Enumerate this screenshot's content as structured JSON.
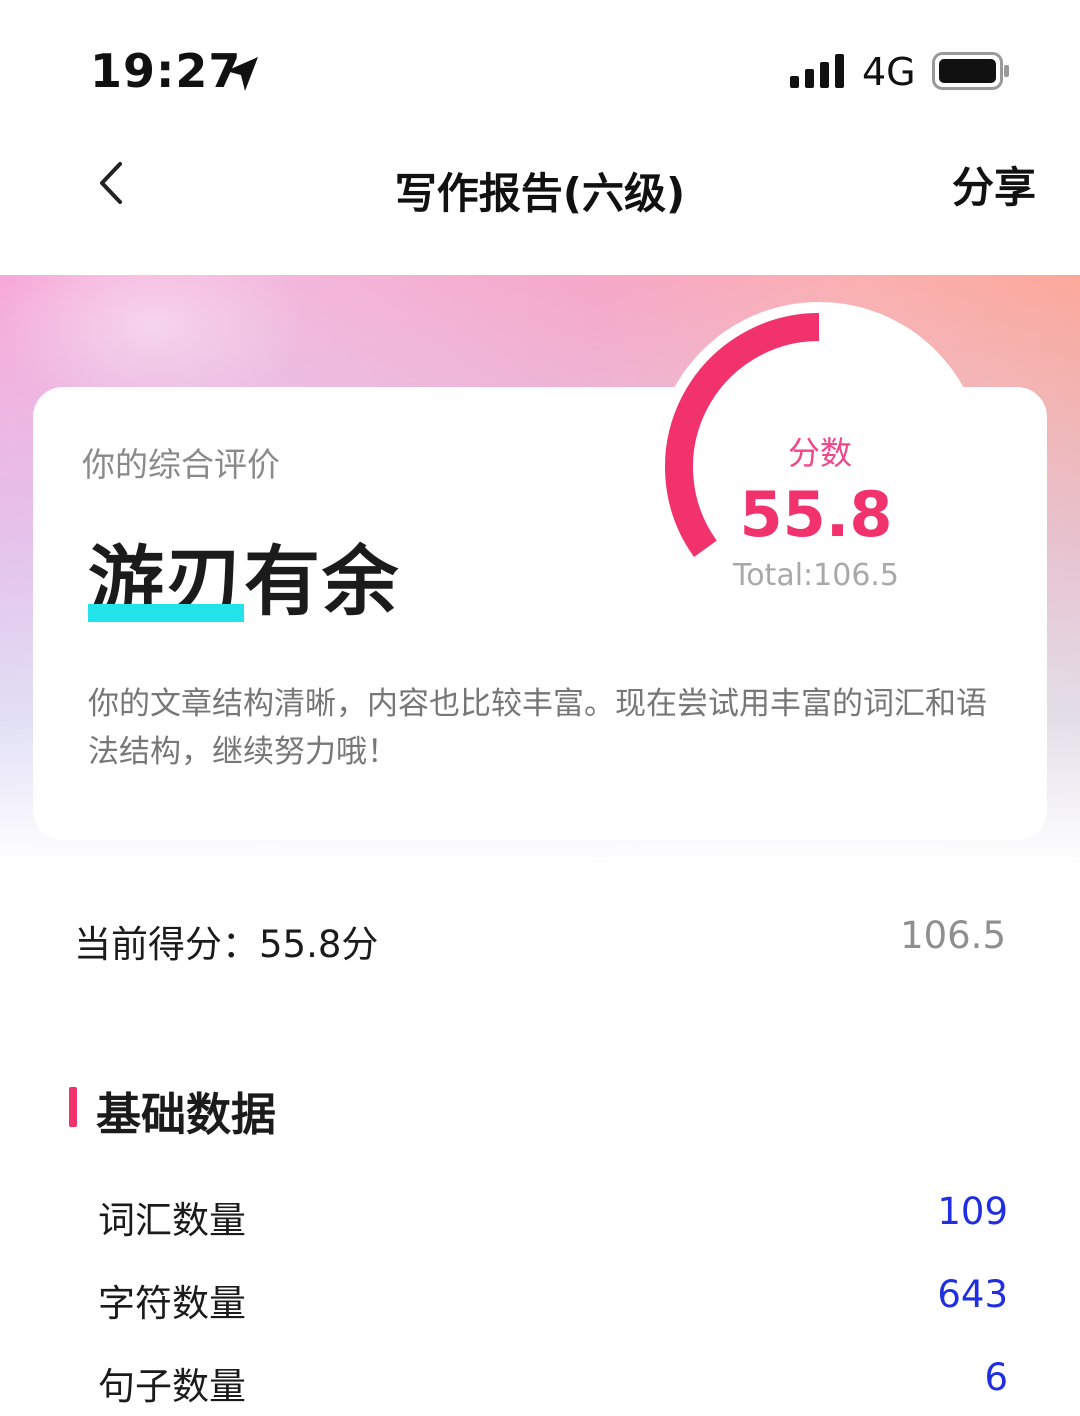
{
  "status_bar": {
    "time": "19:27",
    "network": "4G",
    "icons": [
      "location-arrow-icon",
      "signal-bars-icon",
      "battery-icon"
    ]
  },
  "nav": {
    "title": "写作报告(六级)",
    "share_label": "分享",
    "back_icon": "chevron-left-icon"
  },
  "evaluation": {
    "label": "你的综合评价",
    "value": "游刃有余",
    "comment": "你的文章结构清晰，内容也比较丰富。现在尝试用丰富的词汇和语法结构，继续努力哦！"
  },
  "score": {
    "label": "分数",
    "value": "55.8",
    "total": "Total:106.5",
    "score_number": 55.8,
    "max_number": 106.5
  },
  "current_score": {
    "label": "当前得分：",
    "value": "55.8分",
    "total": "106.5"
  },
  "basic_data": {
    "title": "基础数据",
    "rows": [
      {
        "label": "词汇数量",
        "value": "109"
      },
      {
        "label": "字符数量",
        "value": "643"
      },
      {
        "label": "句子数量",
        "value": "6"
      }
    ]
  },
  "colors": {
    "accent": "#f2326d",
    "highlight": "#23e3ea",
    "stat_value": "#1e2ee0"
  }
}
